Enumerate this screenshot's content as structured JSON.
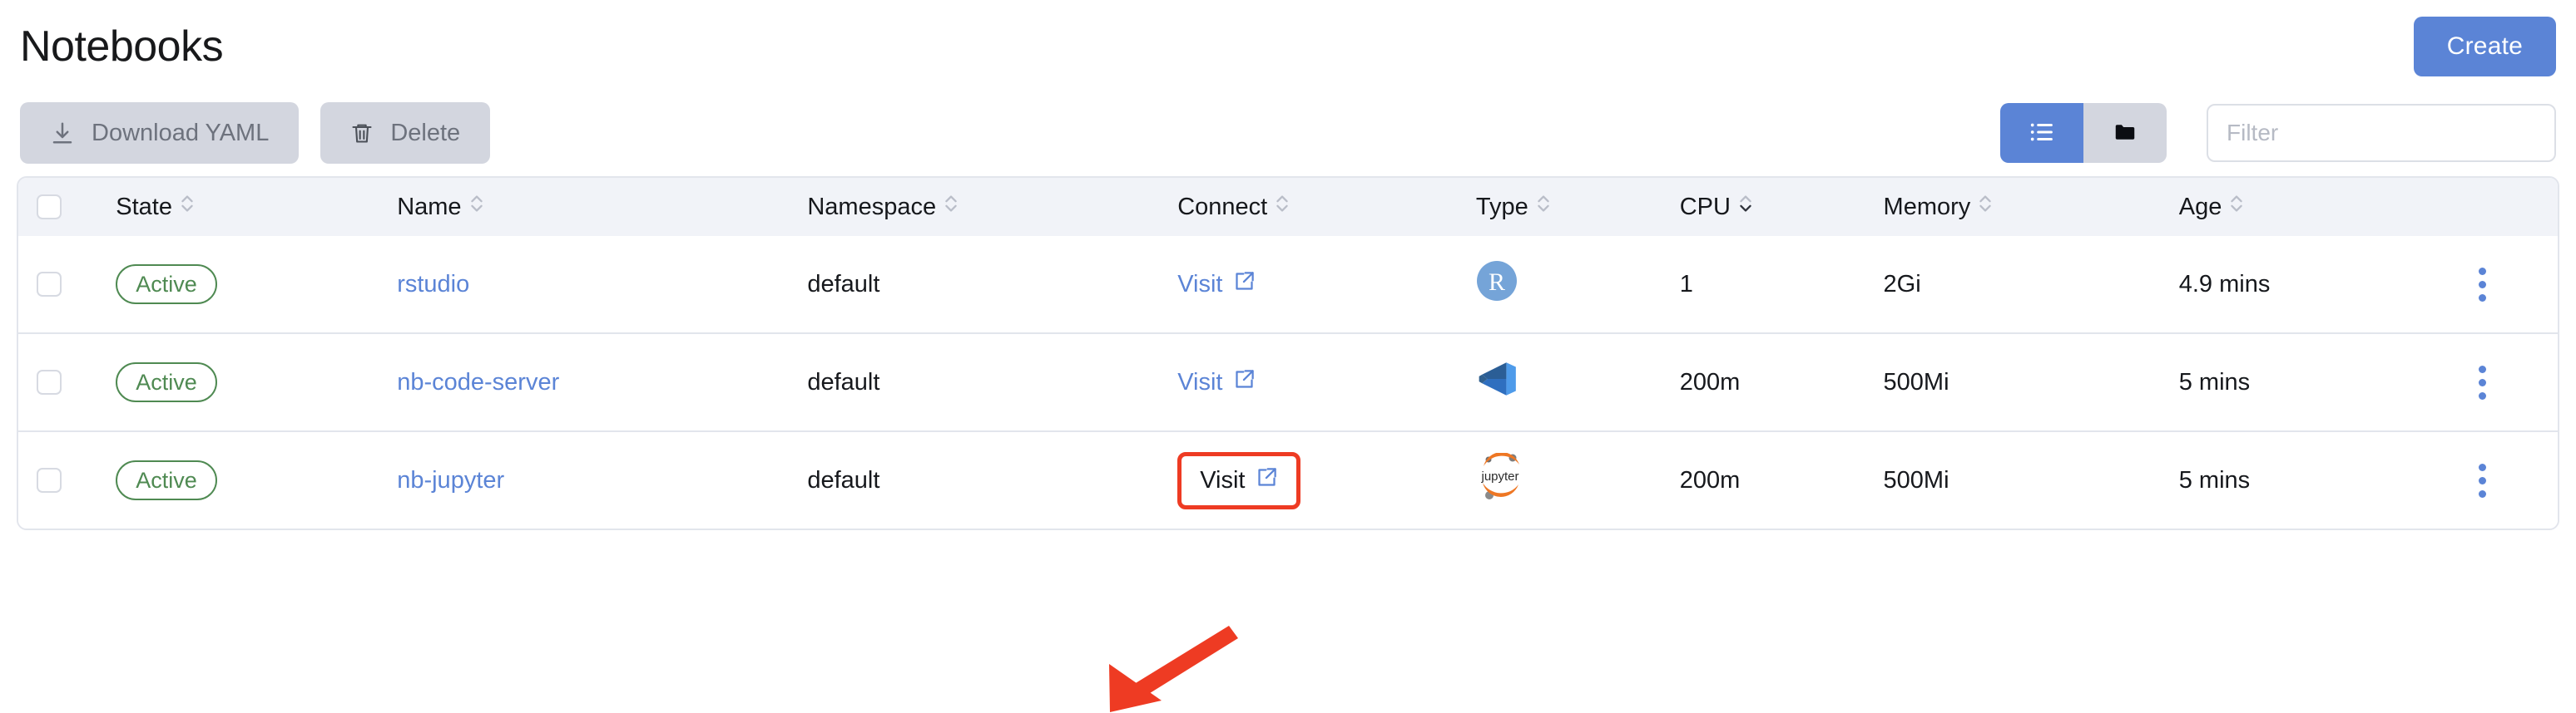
{
  "header": {
    "title": "Notebooks",
    "create_label": "Create"
  },
  "toolbar": {
    "download_yaml_label": "Download YAML",
    "delete_label": "Delete",
    "download_icon": "download-icon",
    "delete_icon": "trash-icon",
    "view_list_icon": "list-view-icon",
    "view_folder_icon": "folder-view-icon",
    "filter_placeholder": "Filter",
    "filter_value": ""
  },
  "table": {
    "columns": [
      {
        "key": "state",
        "label": "State",
        "sortable": true
      },
      {
        "key": "name",
        "label": "Name",
        "sortable": true
      },
      {
        "key": "namespace",
        "label": "Namespace",
        "sortable": true
      },
      {
        "key": "connect",
        "label": "Connect",
        "sortable": true
      },
      {
        "key": "type",
        "label": "Type",
        "sortable": true
      },
      {
        "key": "cpu",
        "label": "CPU",
        "sortable": true
      },
      {
        "key": "memory",
        "label": "Memory",
        "sortable": true
      },
      {
        "key": "age",
        "label": "Age",
        "sortable": true
      }
    ],
    "rows": [
      {
        "state": "Active",
        "name": "rstudio",
        "namespace": "default",
        "connect": "Visit",
        "type_icon": "rstudio-logo",
        "cpu": "1",
        "memory": "2Gi",
        "age": "4.9 mins",
        "highlighted": false
      },
      {
        "state": "Active",
        "name": "nb-code-server",
        "namespace": "default",
        "connect": "Visit",
        "type_icon": "vscode-logo",
        "cpu": "200m",
        "memory": "500Mi",
        "age": "5 mins",
        "highlighted": false
      },
      {
        "state": "Active",
        "name": "nb-jupyter",
        "namespace": "default",
        "connect": "Visit",
        "type_icon": "jupyter-logo",
        "cpu": "200m",
        "memory": "500Mi",
        "age": "5 mins",
        "highlighted": true
      }
    ]
  },
  "annotation": {
    "highlight_color": "#ee3b23",
    "arrow_color": "#ee3b23",
    "target": "Visit"
  },
  "colors": {
    "accent": "#5b84d6",
    "badge_green": "#4f8a52",
    "toolbar_grey": "#d3d6df",
    "header_bg": "#f1f3f8",
    "border": "#e2e5ec"
  }
}
